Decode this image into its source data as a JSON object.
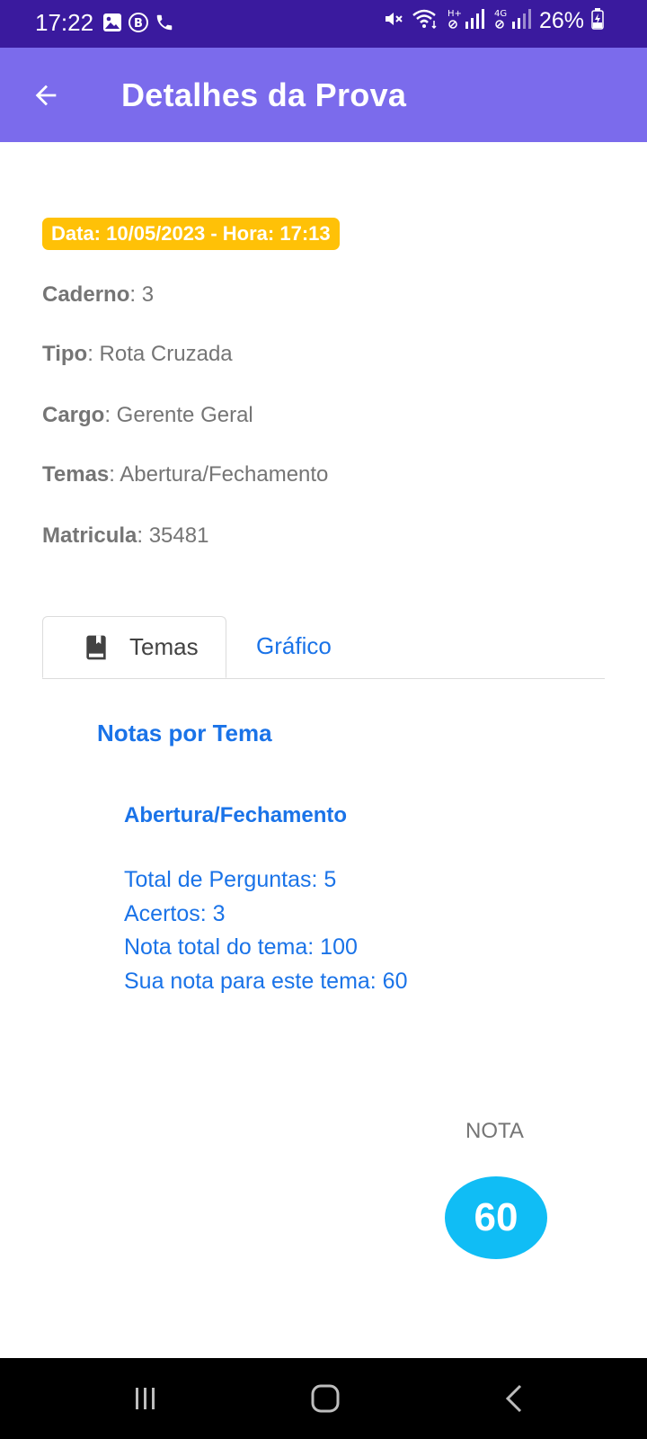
{
  "status_bar": {
    "time": "17:22",
    "battery": "26%",
    "icons_left": [
      "image-icon",
      "b-circle-icon",
      "phone-icon"
    ],
    "icons_right": [
      "mute-icon",
      "wifi-icon",
      "h-plus-signal-icon",
      "4g-signal-icon",
      "battery-charging-icon"
    ]
  },
  "app_bar": {
    "title": "Detalhes da Prova",
    "color": "#7b6bec"
  },
  "exam": {
    "date_badge": "Data: 10/05/2023 - Hora: 17:13",
    "caderno_label": "Caderno",
    "caderno_value": ": 3",
    "tipo_label": "Tipo",
    "tipo_value": ": Rota Cruzada",
    "cargo_label": "Cargo",
    "cargo_value": ": Gerente Geral",
    "temas_label": "Temas",
    "temas_value": ": Abertura/Fechamento",
    "matricula_label": "Matricula",
    "matricula_value": ": 35481"
  },
  "tabs": [
    {
      "label": "Temas",
      "icon": "book-icon",
      "active": true
    },
    {
      "label": "Gráfico",
      "active": false
    }
  ],
  "notes": {
    "section_title": "Notas por Tema",
    "topic": "Abertura/Fechamento",
    "total_perguntas": "Total de Perguntas: 5",
    "acertos": "Acertos: 3",
    "nota_total": "Nota total do tema: 100",
    "sua_nota": "Sua nota para este tema: 60"
  },
  "score": {
    "label": "NOTA",
    "value": "60",
    "color": "#10bdf5"
  },
  "nav_bar": [
    "recent-apps-icon",
    "home-icon",
    "back-icon"
  ]
}
